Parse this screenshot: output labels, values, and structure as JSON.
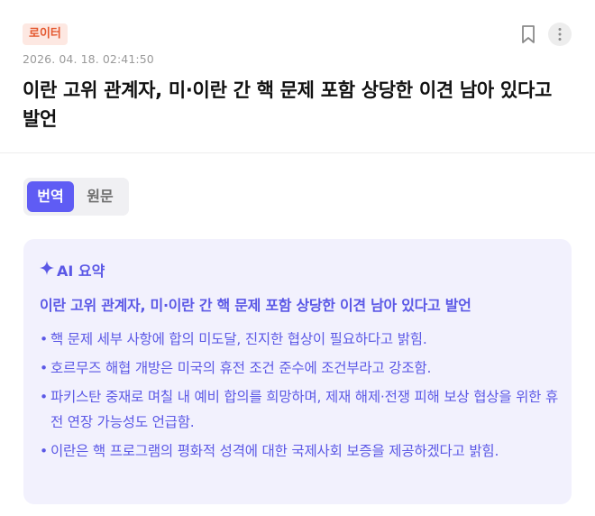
{
  "article": {
    "source": "로이터",
    "timestamp": "2026. 04. 18. 02:41:50",
    "title": "이란 고위 관계자, 미·이란 간 핵 문제 포함 상당한 이견 남아 있다고 발언"
  },
  "actions": {
    "bookmark_icon": "bookmark-icon",
    "more_icon": "more-vertical-icon"
  },
  "toggle": {
    "translated_label": "번역",
    "original_label": "원문",
    "selected": "번역"
  },
  "summary": {
    "label": "AI 요약",
    "title": "이란 고위 관계자, 미·이란 간 핵 문제 포함 상당한 이견 남아 있다고 발언",
    "bullets": [
      "핵 문제 세부 사항에 합의 미도달, 진지한 협상이 필요하다고 밝힘.",
      "호르무즈 해협 개방은 미국의 휴전 조건 준수에 조건부라고 강조함.",
      "파키스탄 중재로 며칠 내 예비 합의를 희망하며, 제재 해제·전쟁 피해 보상 협상을 위한 휴전 연장 가능성도 언급함.",
      "이란은 핵 프로그램의 평화적 성격에 대한 국제사회 보증을 제공하겠다고 밝힘."
    ]
  },
  "colors": {
    "accent": "#5b58e6",
    "toggle_active": "#5f5cf4",
    "badge_bg": "#fde8e2",
    "badge_text": "#e4572e",
    "summary_bg": "#f2f1fd"
  }
}
